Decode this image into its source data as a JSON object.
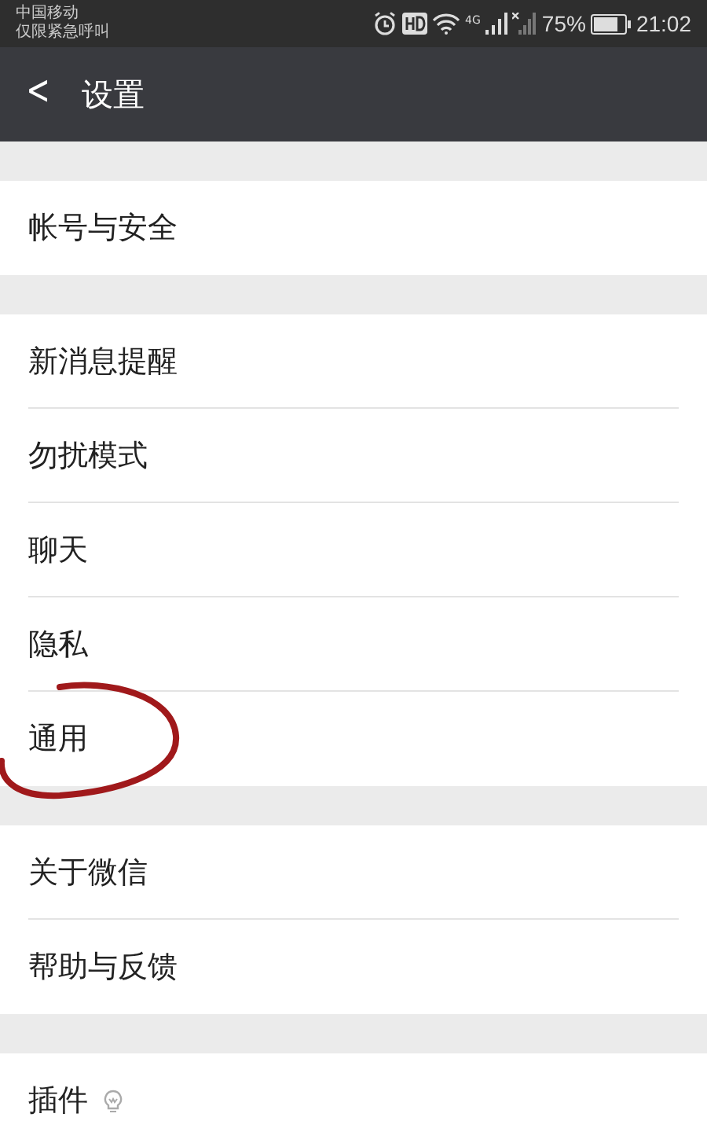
{
  "status_bar": {
    "carrier_lines": [
      "中国移动",
      "仅限紧急呼叫"
    ],
    "network": "4G",
    "battery": "75%",
    "time": "21:02"
  },
  "header": {
    "back": "<",
    "title": "设置"
  },
  "groups": [
    {
      "items": [
        {
          "label": "帐号与安全",
          "circled": false
        }
      ]
    },
    {
      "items": [
        {
          "label": "新消息提醒",
          "circled": false
        },
        {
          "label": "勿扰模式",
          "circled": false
        },
        {
          "label": "聊天",
          "circled": false
        },
        {
          "label": "隐私",
          "circled": false
        },
        {
          "label": "通用",
          "circled": true
        }
      ]
    },
    {
      "items": [
        {
          "label": "关于微信",
          "circled": false
        },
        {
          "label": "帮助与反馈",
          "circled": false
        }
      ]
    },
    {
      "items": [
        {
          "label": "插件",
          "circled": false,
          "kind": "plugin"
        }
      ]
    }
  ]
}
